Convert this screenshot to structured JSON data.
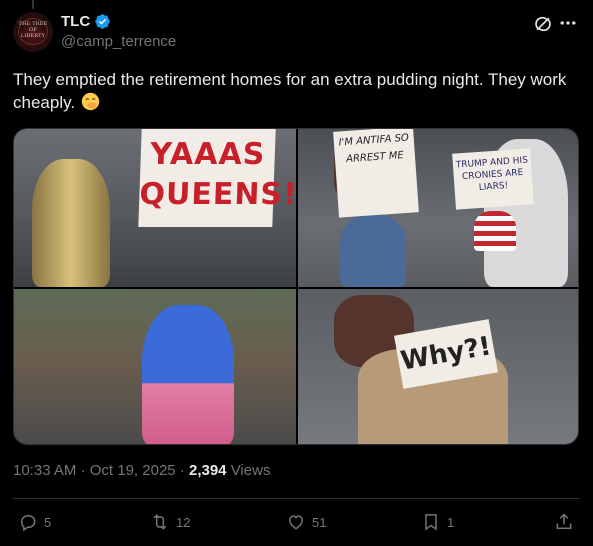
{
  "author": {
    "display_name": "TLC",
    "handle": "@camp_terrence",
    "avatar_text": "THE TREE OF LIBERTY",
    "verified": true
  },
  "tweet": {
    "text": "They emptied the retirement homes for an extra pudding night. They work cheaply.",
    "emoji": "face-with-hand-over-mouth"
  },
  "media": {
    "photos": [
      {
        "sign_text": "YAAAS QUEENS!"
      },
      {
        "sign_text": "I'M ANTIFA SO ARREST ME",
        "sign_text_2": "TRUMP AND HIS CRONIES ARE LIARS!"
      },
      {
        "sign_text": ""
      },
      {
        "sign_text": "Why?!"
      }
    ]
  },
  "meta": {
    "time": "10:33 AM",
    "dot1": "·",
    "date": "Oct 19, 2025",
    "dot2": "·",
    "views_count": "2,394",
    "views_label": "Views"
  },
  "actions": {
    "replies": "5",
    "retweets": "12",
    "likes": "51",
    "bookmarks": "1"
  },
  "colors": {
    "background": "#000000",
    "text": "#e7e9ea",
    "muted": "#71767b",
    "verified": "#1d9bf0",
    "border": "#2f3336"
  }
}
